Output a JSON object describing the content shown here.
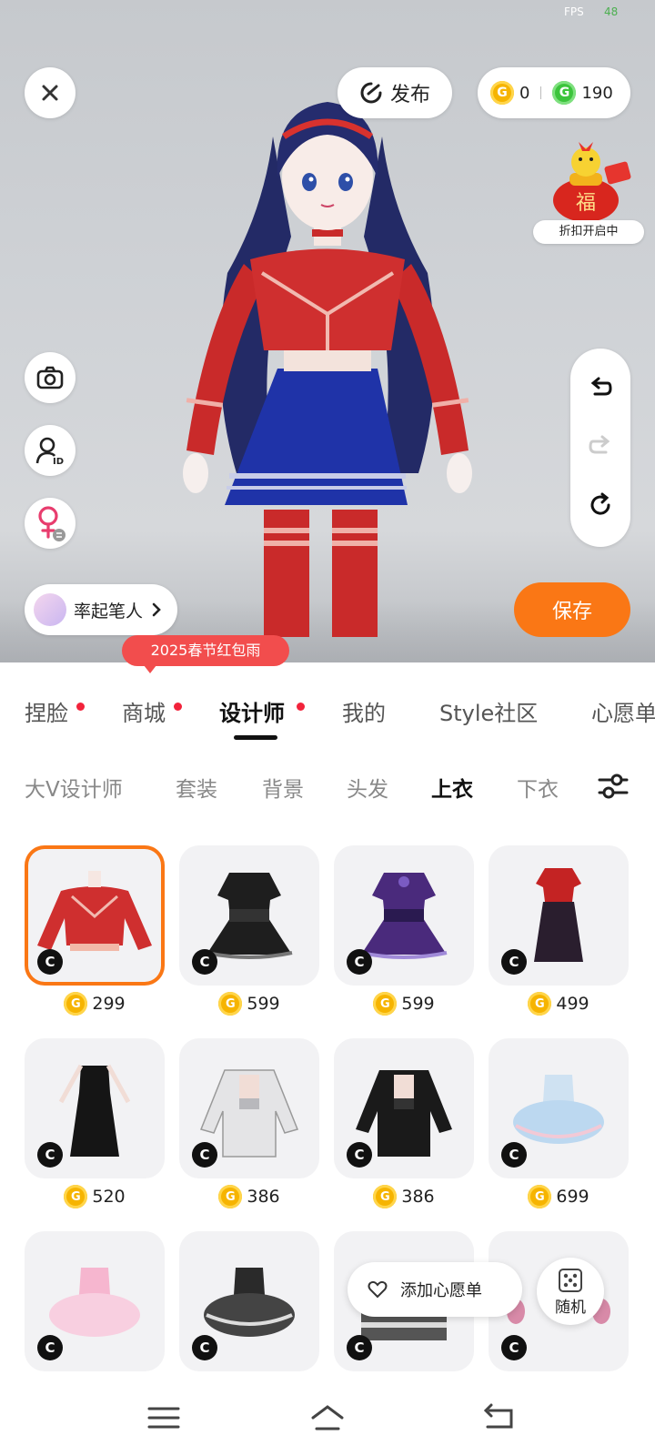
{
  "status": {
    "fps_label": "FPS",
    "fps_value": "48"
  },
  "topbar": {
    "publish_label": "发布",
    "coins_gold": "0",
    "coins_green": "190"
  },
  "promo": {
    "label": "折扣开启中",
    "badge_text": "福"
  },
  "author": {
    "name": "率起笔人"
  },
  "save_label": "保存",
  "event_tag": "2025春节红包雨",
  "tabs": [
    {
      "label": "捏脸",
      "dot": true
    },
    {
      "label": "商城",
      "dot": true
    },
    {
      "label": "设计师",
      "dot": true,
      "active": true
    },
    {
      "label": "我的",
      "dot": false
    },
    {
      "label": "Style社区",
      "dot": false
    },
    {
      "label": "心愿单",
      "dot": false
    }
  ],
  "subtabs": [
    "大V设计师",
    "套装",
    "背景",
    "头发",
    "上衣",
    "下衣"
  ],
  "active_subtab": "上衣",
  "items": [
    {
      "price": "299",
      "kind": "red-sweater",
      "selected": true
    },
    {
      "price": "599",
      "kind": "black-dress"
    },
    {
      "price": "599",
      "kind": "purple-dress"
    },
    {
      "price": "499",
      "kind": "red-long-dress"
    },
    {
      "price": "520",
      "kind": "black-gown"
    },
    {
      "price": "386",
      "kind": "white-jacket"
    },
    {
      "price": "386",
      "kind": "black-jacket"
    },
    {
      "price": "699",
      "kind": "blue-tutu"
    },
    {
      "price": "",
      "kind": "pink-tutu"
    },
    {
      "price": "",
      "kind": "black-lolita"
    },
    {
      "price": "",
      "kind": "black-white"
    },
    {
      "price": "",
      "kind": "pink-doll"
    }
  ],
  "creator_badge": "C",
  "coin_glyph": "G",
  "wishlist_label": "添加心愿单",
  "random_label": "随机",
  "colors": {
    "accent": "#fa7715",
    "event_red": "#f24d4d",
    "dot_red": "#f2233b",
    "coin_gold": "#f6b400",
    "coin_green": "#3cc43c"
  }
}
